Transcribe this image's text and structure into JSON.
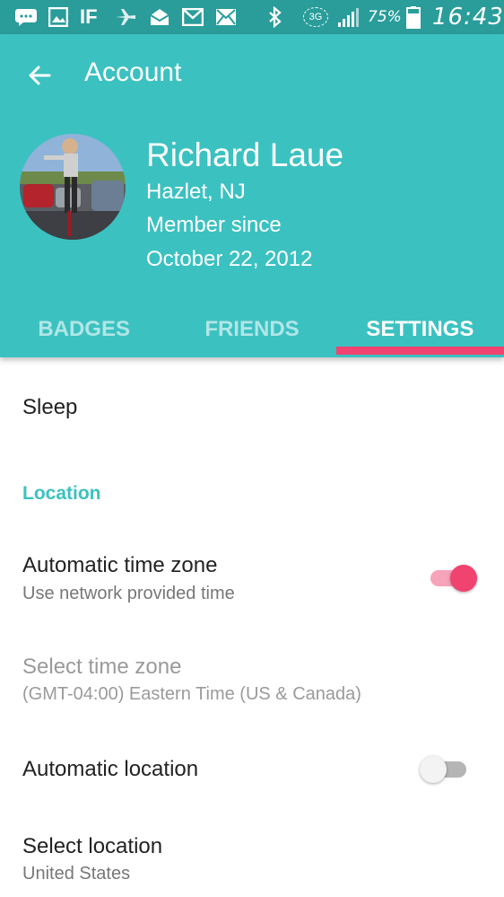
{
  "status_bar": {
    "battery_text": "75%",
    "time": "16:43",
    "network_badge": "3G",
    "icons": [
      "message-icon",
      "gallery-icon",
      "ifttt-icon",
      "plane-icon",
      "mail-open-icon",
      "gmail-icon",
      "mail-icon",
      "bluetooth-icon",
      "3g-icon",
      "signal-icon",
      "battery-icon"
    ]
  },
  "app_bar": {
    "title": "Account",
    "back_icon": "arrow-left-icon"
  },
  "profile": {
    "name": "Richard Laue",
    "location": "Hazlet, NJ",
    "member_since_label": "Member since",
    "member_since_date": "October 22, 2012"
  },
  "tabs": [
    {
      "label": "BADGES",
      "active": false
    },
    {
      "label": "FRIENDS",
      "active": false
    },
    {
      "label": "SETTINGS",
      "active": true
    }
  ],
  "settings": {
    "sleep_label": "Sleep",
    "location_header": "Location",
    "auto_timezone": {
      "title": "Automatic time zone",
      "subtitle": "Use network provided time",
      "enabled": true
    },
    "select_timezone": {
      "title": "Select time zone",
      "subtitle": "(GMT-04:00) Eastern Time (US & Canada)"
    },
    "auto_location": {
      "title": "Automatic location",
      "enabled": false
    },
    "select_location": {
      "title": "Select location",
      "subtitle": "United States"
    }
  },
  "colors": {
    "status_bar": "#2a9d9b",
    "app_bar": "#3cc1c1",
    "accent": "#f0436f",
    "section_header": "#3cc1c1"
  }
}
